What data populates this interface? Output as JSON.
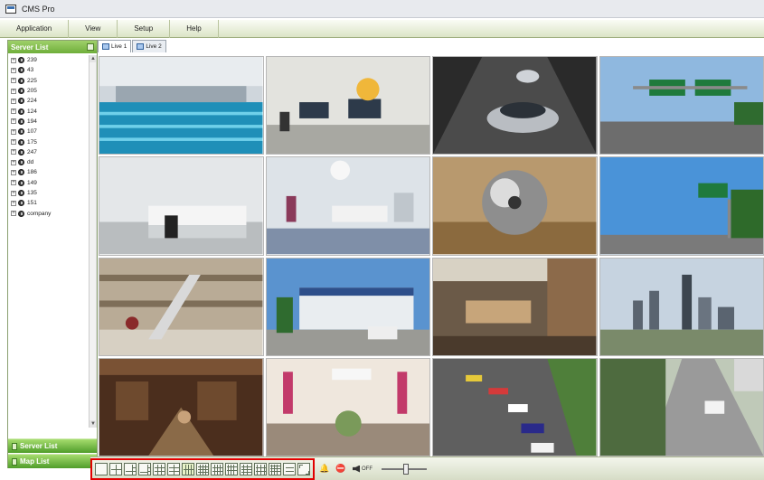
{
  "app": {
    "title": "CMS Pro"
  },
  "menu": [
    "Application",
    "View",
    "Setup",
    "Help"
  ],
  "sidebar": {
    "header": "Server List",
    "servers": [
      "239",
      "43",
      "225",
      "205",
      "224",
      "124",
      "194",
      "107",
      "175",
      "247",
      "dd",
      "186",
      "149",
      "135",
      "151",
      "company"
    ],
    "buttons": {
      "server_list": "Server List",
      "map_list": "Map List"
    }
  },
  "tabs": [
    "Live 1",
    "Live 2"
  ],
  "toolbar": {
    "audio_state": "OFF"
  },
  "cameras": [
    "indoor-pool",
    "control-room",
    "sports-car",
    "highway-sign",
    "laboratory",
    "hospital-room",
    "chrome-sphere",
    "freeway-exit",
    "shopping-mall",
    "city-building",
    "office-lobby",
    "city-skyline",
    "restaurant",
    "macys-store",
    "race-track",
    "parking-road"
  ],
  "colors": {
    "accent_green": "#6fae3a",
    "highlight_red": "#e10000"
  }
}
